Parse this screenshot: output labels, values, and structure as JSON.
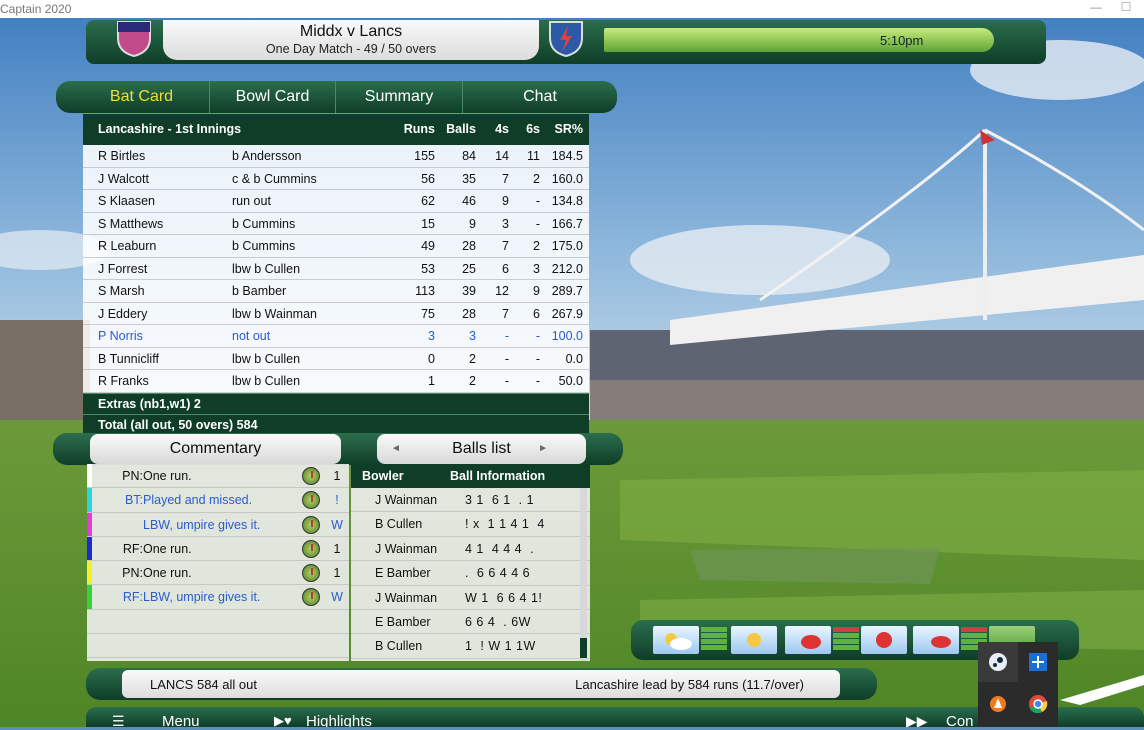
{
  "window": {
    "title": "Captain 2020",
    "controls": [
      "—",
      "☐"
    ]
  },
  "header": {
    "match_title": "Middx v Lancs",
    "match_subtitle": "One Day Match - 49 / 50 overs",
    "time": "5:10pm"
  },
  "tabs": [
    {
      "label": "Bat Card",
      "active": true
    },
    {
      "label": "Bowl Card"
    },
    {
      "label": "Summary"
    },
    {
      "label": "Chat"
    }
  ],
  "colors": {
    "active_tab": "#f0dc3c",
    "not_out": "#2a5bd3",
    "panel_green": "#0f3d28"
  },
  "bat_card": {
    "innings_title": "Lancashire - 1st Innings",
    "columns": [
      "Runs",
      "Balls",
      "4s",
      "6s",
      "SR%"
    ],
    "rows": [
      {
        "name": "R Birtles",
        "how": "b Andersson",
        "runs": "155",
        "balls": "84",
        "fours": "14",
        "sixes": "11",
        "sr": "184.5"
      },
      {
        "name": "J Walcott",
        "how": "c & b Cummins",
        "runs": "56",
        "balls": "35",
        "fours": "7",
        "sixes": "2",
        "sr": "160.0"
      },
      {
        "name": "S Klaasen",
        "how": "run out",
        "runs": "62",
        "balls": "46",
        "fours": "9",
        "sixes": "-",
        "sr": "134.8"
      },
      {
        "name": "S Matthews",
        "how": "b Cummins",
        "runs": "15",
        "balls": "9",
        "fours": "3",
        "sixes": "-",
        "sr": "166.7"
      },
      {
        "name": "R Leaburn",
        "how": "b Cummins",
        "runs": "49",
        "balls": "28",
        "fours": "7",
        "sixes": "2",
        "sr": "175.0"
      },
      {
        "name": "J Forrest",
        "how": "lbw b Cullen",
        "runs": "53",
        "balls": "25",
        "fours": "6",
        "sixes": "3",
        "sr": "212.0"
      },
      {
        "name": "S Marsh",
        "how": "b Bamber",
        "runs": "113",
        "balls": "39",
        "fours": "12",
        "sixes": "9",
        "sr": "289.7"
      },
      {
        "name": "J Eddery",
        "how": "lbw b Wainman",
        "runs": "75",
        "balls": "28",
        "fours": "7",
        "sixes": "6",
        "sr": "267.9"
      },
      {
        "name": "P Norris",
        "how": "not out",
        "runs": "3",
        "balls": "3",
        "fours": "-",
        "sixes": "-",
        "sr": "100.0",
        "highlight": true
      },
      {
        "name": "B Tunnicliff",
        "how": "lbw b Cullen",
        "runs": "0",
        "balls": "2",
        "fours": "-",
        "sixes": "-",
        "sr": "0.0"
      },
      {
        "name": "R Franks",
        "how": "lbw b Cullen",
        "runs": "1",
        "balls": "2",
        "fours": "-",
        "sixes": "-",
        "sr": "50.0"
      }
    ],
    "extras": "Extras (nb1,w1) 2",
    "total": "Total (all out, 50 overs) 584"
  },
  "commentary": {
    "label": "Commentary",
    "rows": [
      {
        "who": "PN:",
        "text": "One run.",
        "result": "1",
        "color": "#ffffff",
        "blue": false
      },
      {
        "who": "BT:",
        "text": "Played and missed.",
        "result": "!",
        "color": "#2ad4e4",
        "blue": true
      },
      {
        "who": "",
        "text": "LBW, umpire gives it.",
        "result": "W",
        "color": "#e53bd8",
        "blue": true
      },
      {
        "who": "RF:",
        "text": "One run.",
        "result": "1",
        "color": "#1d2bd6",
        "blue": false
      },
      {
        "who": "PN:",
        "text": "One run.",
        "result": "1",
        "color": "#f2f22a",
        "blue": false
      },
      {
        "who": "RF:",
        "text": "LBW, umpire gives it.",
        "result": "W",
        "color": "#35d23a",
        "blue": true
      }
    ]
  },
  "balls_list": {
    "label": "Balls list",
    "prev": "◄",
    "next": "►",
    "columns": [
      "Bowler",
      "Ball Information"
    ],
    "rows": [
      {
        "bowler": "J Wainman",
        "info": "3 1  6 1  . 1"
      },
      {
        "bowler": "B Cullen",
        "info": "! x  1 1 4 1  4"
      },
      {
        "bowler": "J Wainman",
        "info": "4 1  4 4 4  ."
      },
      {
        "bowler": "E Bamber",
        "info": ".  6 6 4 4 6"
      },
      {
        "bowler": "J Wainman",
        "info": "W 1  6 6 4 1!"
      },
      {
        "bowler": "E Bamber",
        "info": "6 6 4  . 6W"
      },
      {
        "bowler": "B Cullen",
        "info": "1  ! W 1 1W"
      }
    ]
  },
  "status": {
    "left": "LANCS  584 all out",
    "right": "Lancashire lead by 584 runs (11.7/over)"
  },
  "menu": {
    "menu": "Menu",
    "highlights": "Highlights",
    "continue": "Con"
  },
  "tray": {
    "icons": [
      "steam-icon",
      "plus-icon",
      "avast-icon",
      "chrome-icon"
    ]
  }
}
